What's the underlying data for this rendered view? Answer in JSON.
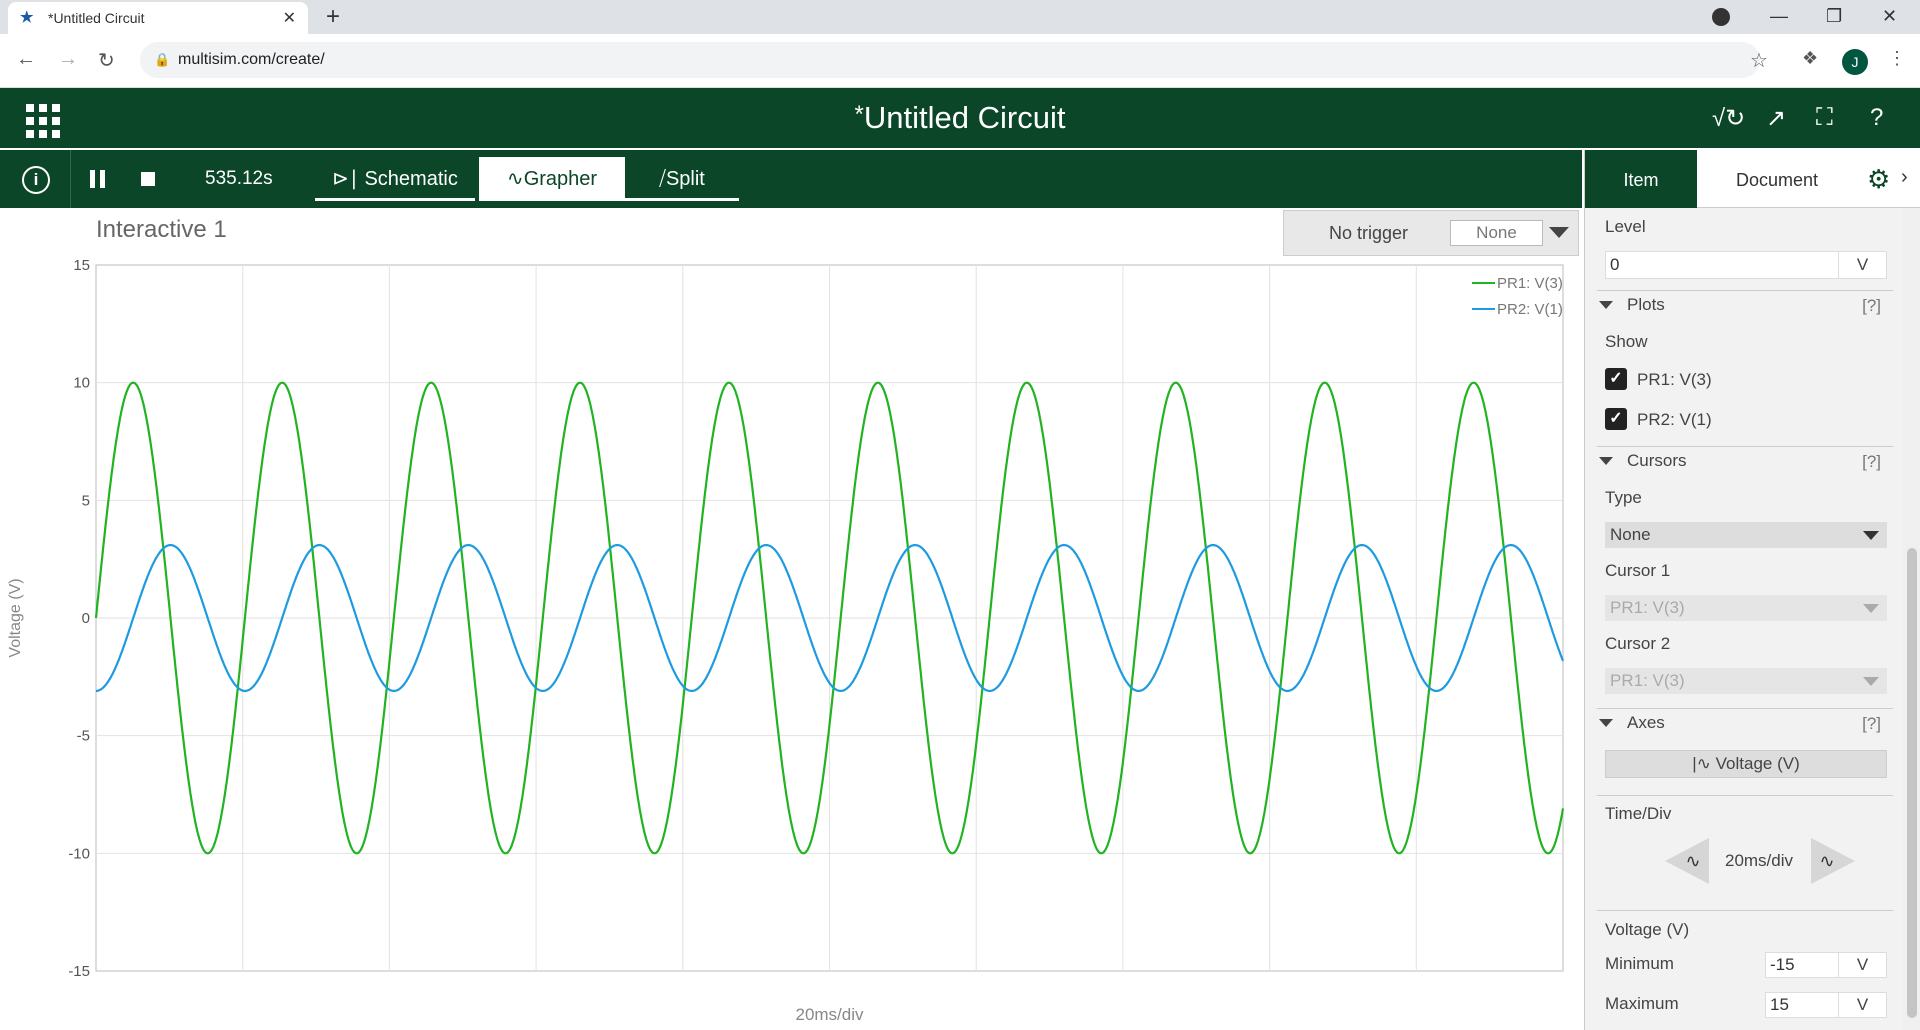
{
  "browser": {
    "tab_title": "*Untitled Circuit",
    "url": "multisim.com/create/",
    "profile_initial": "J"
  },
  "app": {
    "title_marker": "*",
    "title": "Untitled Circuit",
    "accent": "#0b4628"
  },
  "toolbar": {
    "time": "535.12s",
    "tabs": [
      "Schematic",
      "Grapher",
      "Split"
    ],
    "active_tab": "Grapher"
  },
  "graph": {
    "title": "Interactive 1",
    "trigger_label": "No trigger",
    "trigger_value": "None"
  },
  "panel": {
    "tabs": [
      "Item",
      "Document"
    ],
    "level_label": "Level",
    "level_value": "0",
    "level_unit": "V",
    "plots_section": "Plots",
    "help": "[?]",
    "show_label": "Show",
    "plot1": "PR1: V(3)",
    "plot2": "PR2: V(1)",
    "cursors_section": "Cursors",
    "type_label": "Type",
    "type_value": "None",
    "cursor1_label": "Cursor 1",
    "cursor1_value": "PR1: V(3)",
    "cursor2_label": "Cursor 2",
    "cursor2_value": "PR1: V(3)",
    "axes_section": "Axes",
    "axes_button": "Voltage (V)",
    "timediv_label": "Time/Div",
    "timediv_value": "20ms/div",
    "voltage_label": "Voltage (V)",
    "min_label": "Minimum",
    "min_value": "-15",
    "max_label": "Maximum",
    "max_value": "15",
    "unit": "V"
  },
  "chart_data": {
    "type": "line",
    "title": "Interactive 1",
    "xlabel": "20ms/div",
    "ylabel": "Voltage (V)",
    "ylim": [
      -15,
      15
    ],
    "yticks": [
      15,
      10,
      5,
      0,
      -5,
      -10,
      -15
    ],
    "x_divisions": 10,
    "grid": true,
    "legend": "top-right",
    "series": [
      {
        "name": "PR1: V(3)",
        "color": "#22b322",
        "amplitude": 10,
        "offset": 0,
        "cycles": 9.85,
        "phase_deg": 0
      },
      {
        "name": "PR2: V(1)",
        "color": "#1e9be0",
        "amplitude": 3.1,
        "offset": 0,
        "cycles": 9.85,
        "phase_deg": -90
      }
    ]
  }
}
